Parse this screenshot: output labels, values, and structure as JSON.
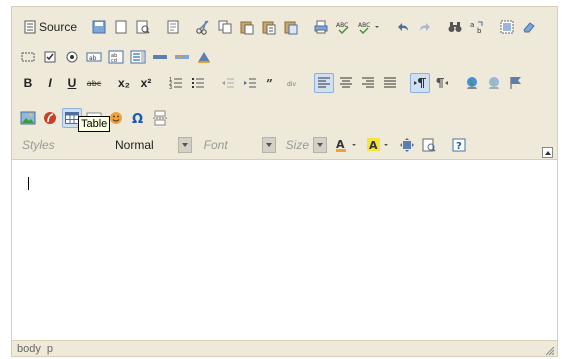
{
  "toolbar": {
    "source_label": "Source",
    "styles": {
      "placeholder": "Styles"
    },
    "format": {
      "value": "Normal"
    },
    "font": {
      "placeholder": "Font"
    },
    "size": {
      "placeholder": "Size"
    },
    "bold_label": "B",
    "italic_label": "I",
    "underline_label": "U",
    "strike_label": "abc",
    "subscript_label": "x₂",
    "superscript_label": "x²",
    "help_label": "?"
  },
  "tooltip": {
    "text": "Table"
  },
  "statusbar": {
    "path": [
      "body",
      "p"
    ]
  },
  "colors": {
    "toolbar_bg": "#efe9da",
    "border": "#d8cfb8",
    "active_button": "#cfe0f5",
    "tooltip_bg": "#ffffe1"
  }
}
